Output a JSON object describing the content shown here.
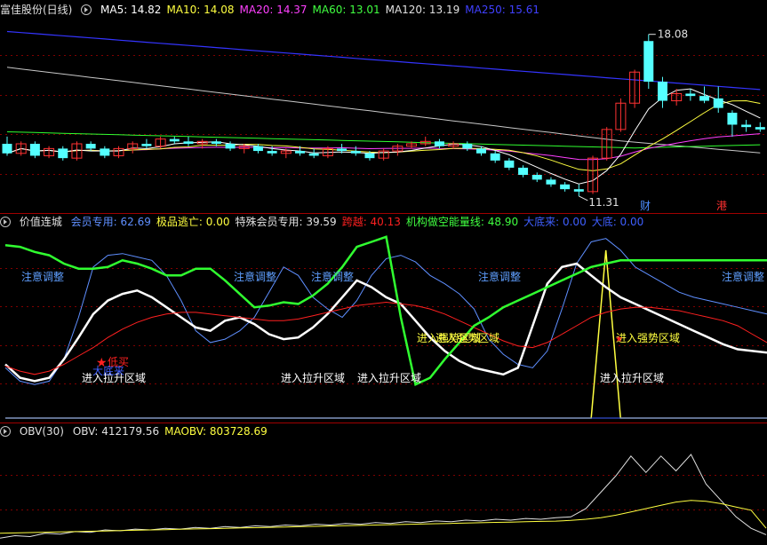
{
  "panels": {
    "main": {
      "title": "富佳股份(日线)",
      "ma": [
        {
          "label": "MA5: 14.82",
          "color": "#ffffff"
        },
        {
          "label": "MA10: 14.08",
          "color": "#ffff40"
        },
        {
          "label": "MA20: 14.37",
          "color": "#ff40ff"
        },
        {
          "label": "MA60: 13.01",
          "color": "#40ff40"
        },
        {
          "label": "MA120: 13.19",
          "color": "#e0e0e0"
        },
        {
          "label": "MA250: 15.61",
          "color": "#4040ff"
        }
      ],
      "high_label": "18.08",
      "low_label": "11.31",
      "tags": [
        {
          "text": "财",
          "color": "#4d8cff"
        },
        {
          "text": "港",
          "color": "#ff3030"
        }
      ]
    },
    "ind": {
      "title": "价值连城",
      "items": [
        {
          "label": "会员专用: 62.69",
          "color": "#5f8fff"
        },
        {
          "label": "极品逃亡: 0.00",
          "color": "#ffff40"
        },
        {
          "label": "特殊会员专用: 39.59",
          "color": "#e0e0e0"
        },
        {
          "label": "跨越: 40.13",
          "color": "#ff2020"
        },
        {
          "label": "机构做空能量线: 48.90",
          "color": "#40ff40"
        },
        {
          "label": "大底来: 0.00",
          "color": "#3f5fff"
        },
        {
          "label": "大底: 0.00",
          "color": "#3f5fff"
        }
      ],
      "annotations": {
        "caution": "注意调整",
        "rise": "进入拉升区域",
        "strong": "进入强势区域",
        "buy": "低买",
        "pivot": "大底来"
      }
    },
    "obv": {
      "title": "OBV(30)",
      "items": [
        {
          "label": "OBV: 412179.56",
          "color": "#e0e0e0"
        },
        {
          "label": "MAOBV: 803728.69",
          "color": "#ffff40"
        }
      ]
    }
  },
  "chart_data": [
    {
      "type": "candlestick",
      "title": "富佳股份(日线)",
      "ylim": [
        10.9,
        18.7
      ],
      "candles": [
        [
          13.5,
          13.8,
          13.0,
          13.1
        ],
        [
          13.1,
          13.6,
          13.0,
          13.5
        ],
        [
          13.5,
          13.6,
          12.9,
          13.0
        ],
        [
          13.0,
          13.4,
          12.9,
          13.3
        ],
        [
          13.3,
          13.4,
          12.8,
          12.9
        ],
        [
          12.9,
          13.6,
          12.8,
          13.5
        ],
        [
          13.5,
          13.6,
          13.2,
          13.3
        ],
        [
          13.3,
          13.4,
          12.9,
          13.0
        ],
        [
          13.0,
          13.4,
          12.9,
          13.3
        ],
        [
          13.3,
          13.6,
          13.1,
          13.5
        ],
        [
          13.5,
          13.7,
          13.3,
          13.4
        ],
        [
          13.4,
          13.8,
          13.3,
          13.7
        ],
        [
          13.7,
          13.8,
          13.5,
          13.6
        ],
        [
          13.6,
          13.8,
          13.4,
          13.5
        ],
        [
          13.5,
          13.7,
          13.3,
          13.6
        ],
        [
          13.6,
          13.7,
          13.4,
          13.5
        ],
        [
          13.5,
          13.6,
          13.2,
          13.3
        ],
        [
          13.3,
          13.5,
          13.1,
          13.4
        ],
        [
          13.4,
          13.5,
          13.1,
          13.2
        ],
        [
          13.2,
          13.4,
          13.0,
          13.1
        ],
        [
          13.1,
          13.3,
          12.9,
          13.2
        ],
        [
          13.2,
          13.4,
          13.0,
          13.1
        ],
        [
          13.1,
          13.3,
          12.9,
          13.0
        ],
        [
          13.0,
          13.4,
          12.9,
          13.3
        ],
        [
          13.3,
          13.5,
          13.1,
          13.2
        ],
        [
          13.2,
          13.4,
          13.0,
          13.1
        ],
        [
          13.1,
          13.2,
          12.8,
          12.9
        ],
        [
          12.9,
          13.3,
          12.8,
          13.2
        ],
        [
          13.2,
          13.5,
          13.0,
          13.4
        ],
        [
          13.4,
          13.6,
          13.3,
          13.5
        ],
        [
          13.5,
          13.8,
          13.4,
          13.6
        ],
        [
          13.6,
          13.7,
          13.3,
          13.4
        ],
        [
          13.4,
          13.6,
          13.3,
          13.5
        ],
        [
          13.5,
          13.6,
          13.2,
          13.3
        ],
        [
          13.3,
          13.4,
          13.0,
          13.1
        ],
        [
          13.1,
          13.2,
          12.7,
          12.8
        ],
        [
          12.8,
          12.9,
          12.4,
          12.5
        ],
        [
          12.5,
          12.6,
          12.1,
          12.2
        ],
        [
          12.2,
          12.3,
          11.9,
          12.0
        ],
        [
          12.0,
          12.1,
          11.7,
          11.8
        ],
        [
          11.8,
          11.9,
          11.5,
          11.6
        ],
        [
          11.6,
          11.8,
          11.31,
          11.5
        ],
        [
          11.5,
          13.0,
          11.4,
          12.9
        ],
        [
          12.9,
          14.2,
          12.8,
          14.1
        ],
        [
          14.1,
          15.4,
          14.0,
          15.2
        ],
        [
          15.2,
          16.6,
          15.0,
          16.5
        ],
        [
          17.8,
          18.08,
          15.8,
          16.1
        ],
        [
          16.1,
          16.3,
          15.0,
          15.3
        ],
        [
          15.3,
          15.8,
          15.1,
          15.6
        ],
        [
          15.6,
          15.8,
          15.3,
          15.5
        ],
        [
          15.5,
          15.9,
          15.2,
          15.3
        ],
        [
          15.4,
          15.9,
          14.8,
          15.0
        ],
        [
          14.8,
          14.9,
          13.8,
          14.3
        ],
        [
          14.3,
          14.5,
          14.0,
          14.2
        ],
        [
          14.2,
          14.4,
          14.0,
          14.1
        ]
      ]
    },
    {
      "type": "line",
      "title": "价值连城",
      "ylim": [
        0,
        110
      ],
      "series": [
        {
          "name": "会员专用",
          "values": [
            30,
            22,
            20,
            22,
            35,
            60,
            90,
            97,
            98,
            96,
            94,
            85,
            70,
            52,
            45,
            47,
            52,
            60,
            75,
            90,
            85,
            72,
            65,
            60,
            70,
            85,
            95,
            97,
            93,
            85,
            80,
            74,
            65,
            47,
            38,
            32,
            30,
            40,
            65,
            92,
            105,
            107,
            100,
            90,
            85,
            80,
            75,
            72,
            70,
            68,
            66,
            64,
            62
          ]
        },
        {
          "name": "极品逃亡",
          "values": [
            0,
            0,
            0,
            0,
            0,
            0,
            0,
            0,
            0,
            0,
            0,
            0,
            0,
            0,
            0,
            0,
            0,
            0,
            0,
            0,
            0,
            0,
            0,
            0,
            0,
            0,
            0,
            0,
            0,
            0,
            0,
            0,
            0,
            0,
            0,
            0,
            0,
            0,
            0,
            0,
            0,
            100,
            0,
            0,
            0,
            0,
            0,
            0,
            0,
            0,
            0,
            0,
            0
          ]
        },
        {
          "name": "特殊会员专用",
          "values": [
            32,
            24,
            22,
            24,
            35,
            48,
            62,
            70,
            74,
            76,
            72,
            66,
            60,
            54,
            52,
            58,
            60,
            56,
            50,
            47,
            48,
            54,
            62,
            72,
            82,
            78,
            72,
            68,
            58,
            48,
            40,
            34,
            30,
            28,
            26,
            30,
            55,
            80,
            90,
            92,
            85,
            78,
            72,
            68,
            64,
            60,
            56,
            52,
            48,
            44,
            41,
            40,
            39
          ]
        },
        {
          "name": "跨越",
          "values": [
            31,
            28,
            26,
            28,
            32,
            37,
            42,
            48,
            53,
            57,
            60,
            62,
            63,
            63,
            62,
            61,
            60,
            59,
            58,
            58,
            59,
            61,
            63,
            65,
            67,
            68,
            69,
            68,
            67,
            65,
            62,
            58,
            54,
            50,
            46,
            43,
            42,
            45,
            50,
            55,
            60,
            63,
            65,
            66,
            66,
            65,
            64,
            62,
            60,
            58,
            55,
            50,
            45
          ]
        },
        {
          "name": "机构做空能量线",
          "values": [
            103,
            102,
            99,
            97,
            92,
            89,
            89,
            90,
            94,
            92,
            89,
            85,
            85,
            89,
            89,
            82,
            74,
            66,
            67,
            69,
            68,
            73,
            80,
            90,
            102,
            105,
            108,
            60,
            20,
            24,
            35,
            45,
            55,
            60,
            66,
            70,
            74,
            78,
            82,
            86,
            90,
            92,
            94,
            94,
            94,
            94,
            94,
            94,
            94,
            94,
            94,
            94,
            94
          ]
        },
        {
          "name": "大底来",
          "values": [
            0,
            0,
            0,
            0,
            0,
            0,
            0,
            0,
            0,
            0,
            0,
            0,
            0,
            0,
            0,
            0,
            0,
            0,
            0,
            0,
            0,
            0,
            0,
            0,
            0,
            0,
            0,
            0,
            0,
            0,
            0,
            0,
            0,
            0,
            0,
            0,
            0,
            0,
            0,
            0,
            0,
            0,
            0,
            0,
            0,
            0,
            0,
            0,
            0,
            0,
            0,
            0,
            0
          ]
        },
        {
          "name": "大底",
          "values": [
            0,
            0,
            0,
            0,
            0,
            0,
            0,
            0,
            0,
            0,
            0,
            0,
            0,
            0,
            0,
            0,
            0,
            0,
            0,
            0,
            0,
            0,
            0,
            0,
            0,
            0,
            0,
            0,
            0,
            0,
            0,
            0,
            0,
            0,
            0,
            0,
            0,
            0,
            0,
            0,
            0,
            0,
            0,
            0,
            0,
            0,
            0,
            0,
            0,
            0,
            0,
            0,
            0
          ]
        }
      ]
    },
    {
      "type": "line",
      "title": "OBV(30)",
      "ylim": [
        0,
        6000000
      ],
      "series": [
        {
          "name": "OBV",
          "values": [
            200000,
            350000,
            300000,
            500000,
            450000,
            600000,
            550000,
            700000,
            650000,
            750000,
            700000,
            800000,
            750000,
            850000,
            800000,
            900000,
            850000,
            950000,
            900000,
            1000000,
            950000,
            1050000,
            1000000,
            1100000,
            1050000,
            1150000,
            1100000,
            1200000,
            1150000,
            1250000,
            1200000,
            1300000,
            1250000,
            1350000,
            1300000,
            1400000,
            1350000,
            1450000,
            1500000,
            2000000,
            3000000,
            4000000,
            5200000,
            4200000,
            5200000,
            4300000,
            5300000,
            3500000,
            2500000,
            1500000,
            800000,
            412179
          ]
        },
        {
          "name": "MAOBV",
          "values": [
            500000,
            520000,
            540000,
            560000,
            580000,
            600000,
            620000,
            640000,
            660000,
            680000,
            700000,
            720000,
            740000,
            760000,
            780000,
            800000,
            820000,
            840000,
            860000,
            880000,
            900000,
            920000,
            940000,
            960000,
            980000,
            1000000,
            1020000,
            1040000,
            1060000,
            1080000,
            1100000,
            1120000,
            1140000,
            1160000,
            1180000,
            1200000,
            1220000,
            1240000,
            1280000,
            1350000,
            1450000,
            1600000,
            1800000,
            2000000,
            2200000,
            2400000,
            2500000,
            2450000,
            2300000,
            2100000,
            1900000,
            803729
          ]
        }
      ]
    }
  ]
}
